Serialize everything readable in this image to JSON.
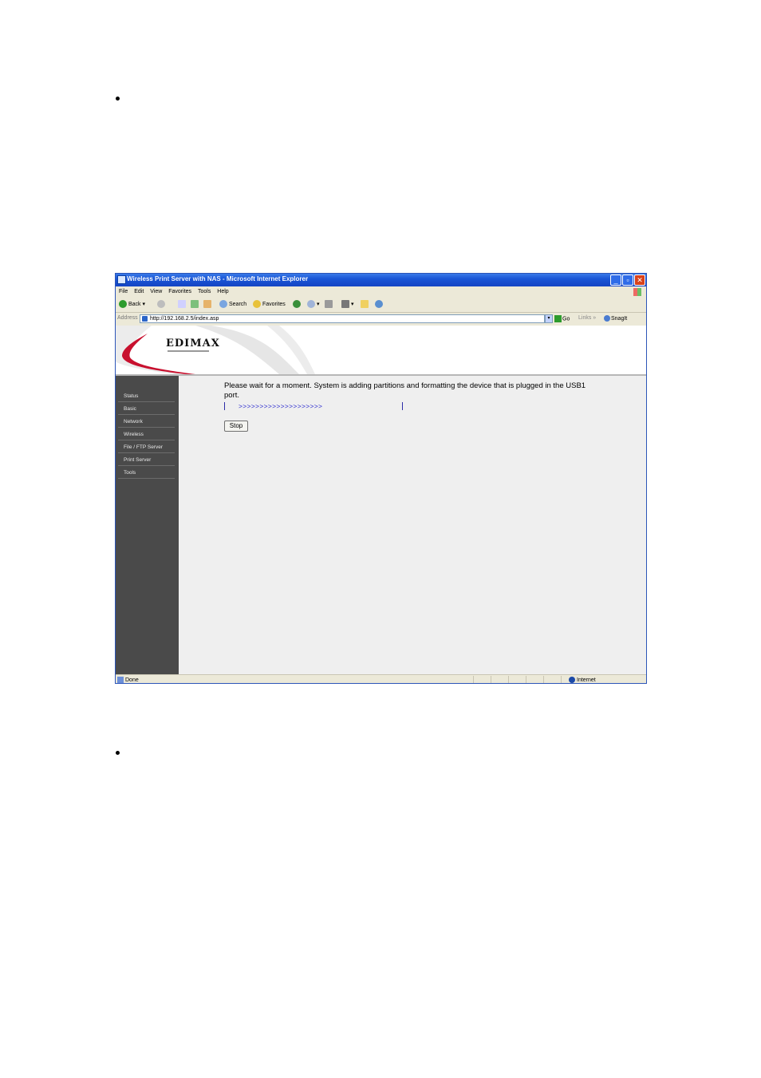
{
  "window": {
    "title": "Wireless Print Server with NAS - Microsoft Internet Explorer",
    "controls": {
      "minimize": "_",
      "maximize": "▫",
      "close": "✕"
    }
  },
  "menu": [
    "File",
    "Edit",
    "View",
    "Favorites",
    "Tools",
    "Help"
  ],
  "toolbar": {
    "back_label": "Back",
    "search_label": "Search",
    "favorites_label": "Favorites"
  },
  "address": {
    "label": "Address",
    "url": "http://192.168.2.5/index.asp",
    "go_label": "Go",
    "links_label": "Links",
    "snagit_label": "SnagIt"
  },
  "header": {
    "logo": "EDIMAX"
  },
  "sidebar": {
    "items": [
      {
        "label": "Status"
      },
      {
        "label": "Basic"
      },
      {
        "label": "Network"
      },
      {
        "label": "Wireless"
      },
      {
        "label": "File / FTP Server"
      },
      {
        "label": "Print Server"
      },
      {
        "label": "Tools"
      }
    ]
  },
  "main": {
    "message": "Please wait for a moment. System is adding partitions and formatting the device that is plugged in the USB1 port.",
    "progress_text": ">>>>>>>>>>>>>>>>>>>>",
    "stop_label": "Stop"
  },
  "status": {
    "left": "Done",
    "zone": "Internet"
  },
  "colors": {
    "titlebar": "#1a56d6",
    "sidebar": "#4a4a4a",
    "progress": "#2f2fcf",
    "logo_red": "#c8102e"
  }
}
